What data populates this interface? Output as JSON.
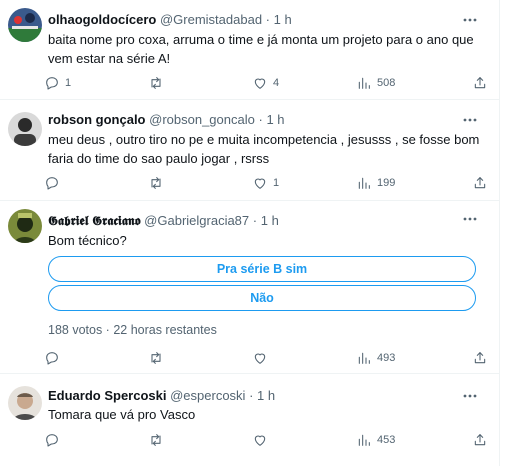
{
  "tweets": [
    {
      "name": "olhaogoldocícero",
      "handle": "@Gremistadabad",
      "dot": "·",
      "time": "1 h",
      "text": "baita nome pro coxa, arruma o time e já monta um projeto para o ano que vem estar na série A!",
      "replies": "1",
      "retweets": "",
      "likes": "4",
      "views": "508"
    },
    {
      "name": "robson gonçalo",
      "handle": "@robson_goncalo",
      "dot": "·",
      "time": "1 h",
      "text": "meu deus , outro tiro no pe e muita incompetencia , jesusss , se fosse bom faria do time do sao paulo jogar , rsrss",
      "replies": "",
      "retweets": "",
      "likes": "1",
      "views": "199"
    },
    {
      "name": "𝕲𝖆𝖇𝖗𝖎𝖊𝖑 𝕲𝖗𝖆𝖈𝖎𝖆𝖓𝖔",
      "handle": "@Gabrielgracia87",
      "dot": "·",
      "time": "1 h",
      "text": "Bom técnico?",
      "poll": {
        "options": [
          "Pra série B sim",
          "Não"
        ],
        "meta": "188 votos · 22 horas restantes"
      },
      "replies": "",
      "retweets": "",
      "likes": "",
      "views": "493"
    },
    {
      "name": "Eduardo Spercoski",
      "handle": "@espercoski",
      "dot": "·",
      "time": "1 h",
      "text": "Tomara que vá pro Vasco",
      "replies": "",
      "retweets": "",
      "likes": "",
      "views": "453"
    }
  ],
  "colors": {
    "accent": "#1d9bf0",
    "text": "#0f1419",
    "muted": "#536471",
    "divider": "#eff3f4"
  }
}
